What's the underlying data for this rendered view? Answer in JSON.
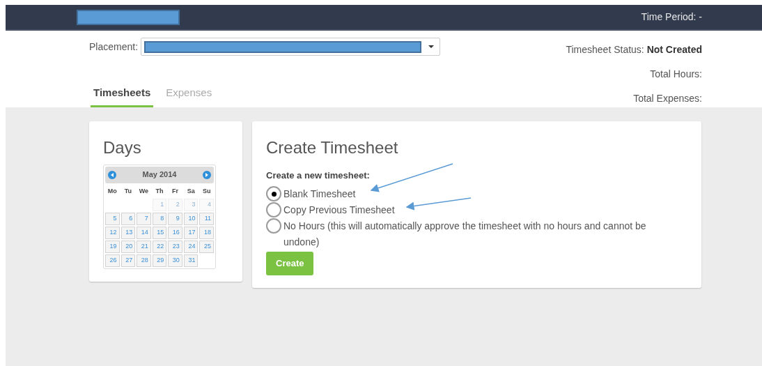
{
  "header": {
    "time_period": "Time Period: -"
  },
  "placement": {
    "label": "Placement:"
  },
  "summary": [
    {
      "label": "Timesheet Status:",
      "value": "Not Created"
    },
    {
      "label": "Total Hours:"
    },
    {
      "label": "Total Expenses:"
    }
  ],
  "tabs": [
    {
      "label": "Timesheets",
      "selected": true
    },
    {
      "label": "Expenses",
      "selected": false
    }
  ],
  "days": {
    "title": "Days",
    "calendar": {
      "month": "May 2014",
      "weekdays": [
        "Mo",
        "Tu",
        "We",
        "Th",
        "Fr",
        "Sa",
        "Su"
      ],
      "weeks": [
        [
          {
            "day": "1",
            "disabled": true
          },
          {
            "day": "2",
            "disabled": true
          },
          {
            "day": "3",
            "disabled": true
          },
          {
            "day": "4",
            "disabled": true
          }
        ],
        [
          {
            "day": "5",
            "disabled": false
          },
          {
            "day": "6",
            "disabled": false
          },
          {
            "day": "7",
            "disabled": false
          },
          {
            "day": "8",
            "disabled": false
          },
          {
            "day": "9",
            "disabled": false
          },
          {
            "day": "10",
            "disabled": false
          },
          {
            "day": "11",
            "disabled": false
          }
        ],
        [
          {
            "day": "12",
            "disabled": false
          },
          {
            "day": "13",
            "disabled": false
          },
          {
            "day": "14",
            "disabled": false
          },
          {
            "day": "15",
            "disabled": false
          },
          {
            "day": "16",
            "disabled": false
          },
          {
            "day": "17",
            "disabled": false
          },
          {
            "day": "18",
            "disabled": false
          }
        ],
        [
          {
            "day": "19",
            "disabled": false
          },
          {
            "day": "20",
            "disabled": false
          },
          {
            "day": "21",
            "disabled": false
          },
          {
            "day": "22",
            "disabled": false
          },
          {
            "day": "23",
            "disabled": false
          },
          {
            "day": "24",
            "disabled": false
          },
          {
            "day": "25",
            "disabled": false
          }
        ],
        [
          {
            "day": "26",
            "disabled": false
          },
          {
            "day": "27",
            "disabled": false
          },
          {
            "day": "28",
            "disabled": false
          },
          {
            "day": "29",
            "disabled": false
          },
          {
            "day": "30",
            "disabled": false
          },
          {
            "day": "31",
            "disabled": false
          }
        ]
      ]
    }
  },
  "create": {
    "title": "Create Timesheet",
    "prompt": "Create a new timesheet:",
    "options": [
      {
        "label": "Blank Timesheet",
        "selected": true
      },
      {
        "label": "Copy Previous Timesheet",
        "selected": false
      },
      {
        "label": "No Hours (this will automatically approve the timesheet with no hours and cannot be undone)",
        "selected": false
      }
    ],
    "button": "Create"
  }
}
